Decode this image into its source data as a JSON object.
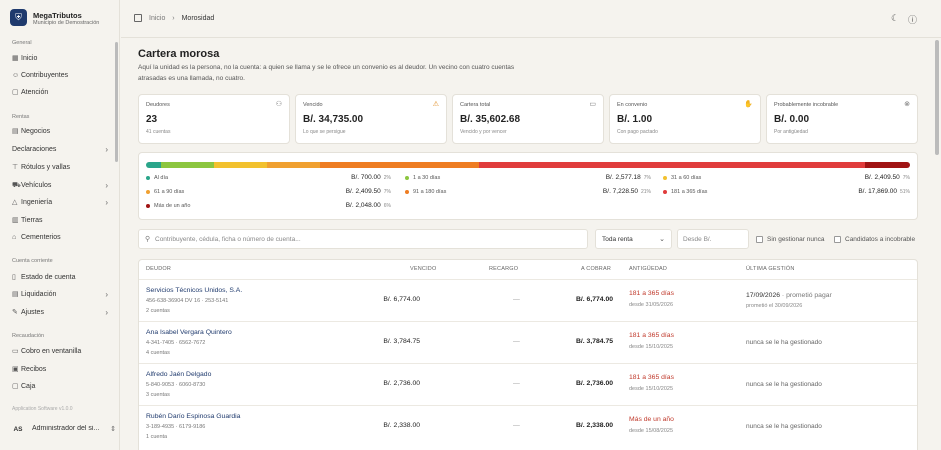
{
  "brand": {
    "name": "MegaTributos",
    "subtitle": "Municipio de Demostración"
  },
  "sidebar": {
    "sections": [
      {
        "label": "General",
        "items": [
          {
            "label": "Inicio",
            "icon": "grid-icon"
          },
          {
            "label": "Contribuyentes",
            "icon": "users-icon"
          },
          {
            "label": "Atención",
            "icon": "chat-icon"
          }
        ]
      },
      {
        "label": "Rentas",
        "items": [
          {
            "label": "Negocios",
            "icon": "store-icon"
          },
          {
            "label": "Declaraciones",
            "icon": "none",
            "chevron": true
          },
          {
            "label": "Rótulos y vallas",
            "icon": "sign-icon"
          },
          {
            "label": "Vehículos",
            "icon": "car-icon",
            "chevron": true
          },
          {
            "label": "Ingeniería",
            "icon": "road-icon",
            "chevron": true
          },
          {
            "label": "Tierras",
            "icon": "map-icon"
          },
          {
            "label": "Cementerios",
            "icon": "building-icon"
          }
        ]
      },
      {
        "label": "Cuenta corriente",
        "items": [
          {
            "label": "Estado de cuenta",
            "icon": "book-icon"
          },
          {
            "label": "Liquidación",
            "icon": "doc-icon",
            "chevron": true
          },
          {
            "label": "Ajustes",
            "icon": "edit-icon",
            "chevron": true
          }
        ]
      },
      {
        "label": "Recaudación",
        "items": [
          {
            "label": "Cobro en ventanilla",
            "icon": "card-icon"
          },
          {
            "label": "Recibos",
            "icon": "receipt-icon"
          },
          {
            "label": "Caja",
            "icon": "box-icon"
          }
        ]
      }
    ],
    "version": "Application Software v1.0.0",
    "user": {
      "initials": "AS",
      "name": "Administrador del si..."
    }
  },
  "breadcrumb": {
    "home": "Inicio",
    "sep": "›",
    "current": "Morosidad"
  },
  "page": {
    "title": "Cartera morosa",
    "description": "Aquí la unidad es la persona, no la cuenta: a quien se llama y se le ofrece un convenio es al deudor. Un vecino con cuatro cuentas atrasadas es una llamada, no cuatro."
  },
  "cards": [
    {
      "label": "Deudores",
      "value": "23",
      "sub": "41 cuentas",
      "icon": "user-icon"
    },
    {
      "label": "Vencido",
      "value": "B/. 34,735.00",
      "sub": "Lo que se persigue",
      "icon": "warning-icon"
    },
    {
      "label": "Cartera total",
      "value": "B/. 35,602.68",
      "sub": "Vencido y por vencer",
      "icon": "wallet-icon"
    },
    {
      "label": "En convenio",
      "value": "B/. 1.00",
      "sub": "Con pago pactado",
      "icon": "handshake-icon"
    },
    {
      "label": "Probablemente incobrable",
      "value": "B/. 0.00",
      "sub": "Por antigüedad",
      "icon": "x-circle-icon"
    }
  ],
  "aging": [
    {
      "label": "Al día",
      "value": "B/. 700.00",
      "pct": "2%",
      "color": "#2aa58a",
      "share": 2
    },
    {
      "label": "1 a 30 días",
      "value": "B/. 2,577.18",
      "pct": "7%",
      "color": "#8cc63f",
      "share": 7
    },
    {
      "label": "31 a 60 días",
      "value": "B/. 2,409.50",
      "pct": "7%",
      "color": "#f2c12e",
      "share": 7
    },
    {
      "label": "61 a 90 días",
      "value": "B/. 2,409.50",
      "pct": "7%",
      "color": "#f0a030",
      "share": 7
    },
    {
      "label": "91 a 180 días",
      "value": "B/. 7,228.50",
      "pct": "21%",
      "color": "#ee7d22",
      "share": 21
    },
    {
      "label": "181 a 365 días",
      "value": "B/. 17,869.00",
      "pct": "51%",
      "color": "#e03c3c",
      "share": 51
    },
    {
      "label": "Más de un año",
      "value": "B/. 2,048.00",
      "pct": "6%",
      "color": "#a01414",
      "share": 6
    }
  ],
  "filters": {
    "search_placeholder": "Contribuyente, cédula, ficha o número de cuenta...",
    "renta": "Toda renta",
    "desde_placeholder": "Desde B/.",
    "chk1": "Sin gestionar nunca",
    "chk2": "Candidatos a incobrable"
  },
  "table": {
    "headers": {
      "deudor": "DEUDOR",
      "vencido": "VENCIDO",
      "recargo": "RECARGO",
      "cobrar": "A COBRAR",
      "antiguedad": "ANTIGÜEDAD",
      "gestion": "ÚLTIMA GESTIÓN"
    },
    "rows": [
      {
        "name": "Servicios Técnicos Unidos, S.A.",
        "ids": "456-638-36904 DV 16 · 253-5141",
        "count": "2 cuentas",
        "vencido": "B/. 6,774.00",
        "recargo": "—",
        "cobrar": "B/. 6,774.00",
        "antig": "181 a 365 días",
        "desde": "desde 31/05/2026",
        "gest_main": "17/09/2026",
        "gest_extra": " · prometió pagar",
        "gest_sub": "prometió el 30/09/2026"
      },
      {
        "name": "Ana Isabel Vergara Quintero",
        "ids": "4-341-7405 · 6562-7672",
        "count": "4 cuentas",
        "vencido": "B/. 3,784.75",
        "recargo": "—",
        "cobrar": "B/. 3,784.75",
        "antig": "181 a 365 días",
        "desde": "desde 15/10/2025",
        "gest_none": "nunca se le ha gestionado"
      },
      {
        "name": "Alfredo Jaén Delgado",
        "ids": "5-840-9053 · 6060-8730",
        "count": "3 cuentas",
        "vencido": "B/. 2,736.00",
        "recargo": "—",
        "cobrar": "B/. 2,736.00",
        "antig": "181 a 365 días",
        "desde": "desde 15/10/2025",
        "gest_none": "nunca se le ha gestionado"
      },
      {
        "name": "Rubén Darío Espinosa Guardia",
        "ids": "3-189-4935 · 6179-9186",
        "count": "1 cuenta",
        "vencido": "B/. 2,338.00",
        "recargo": "—",
        "cobrar": "B/. 2,338.00",
        "antig": "Más de un año",
        "desde": "desde 15/08/2025",
        "gest_none": "nunca se le ha gestionado"
      }
    ]
  }
}
